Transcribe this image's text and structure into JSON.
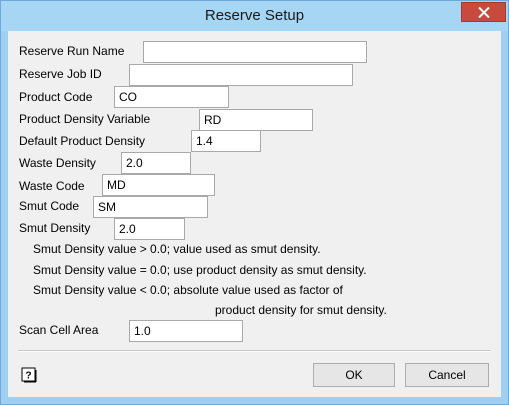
{
  "window": {
    "title": "Reserve Setup",
    "close_label": "×"
  },
  "form": {
    "reserve_run_name": {
      "label": "Reserve Run Name",
      "value": ""
    },
    "reserve_job_id": {
      "label": "Reserve Job ID",
      "value": ""
    },
    "product_code": {
      "label": "Product Code",
      "value": "CO"
    },
    "product_density_variable": {
      "label": "Product Density Variable",
      "value": "RD"
    },
    "default_product_density": {
      "label": "Default Product Density",
      "value": "1.4"
    },
    "waste_density": {
      "label": "Waste Density",
      "value": "2.0"
    },
    "waste_code": {
      "label": "Waste Code",
      "value": "MD"
    },
    "smut_code": {
      "label": "Smut Code",
      "value": "SM"
    },
    "smut_density": {
      "label": "Smut Density",
      "value": "2.0"
    },
    "scan_cell_area": {
      "label": "Scan Cell Area",
      "value": "1.0"
    }
  },
  "notes": {
    "line1": "Smut Density value > 0.0; value used as smut density.",
    "line2": "Smut Density value = 0.0; use product density as smut density.",
    "line3": "Smut Density value < 0.0; absolute value used as factor of",
    "line4": "product density for smut density."
  },
  "buttons": {
    "ok": "OK",
    "cancel": "Cancel",
    "help_icon": "help-icon"
  }
}
